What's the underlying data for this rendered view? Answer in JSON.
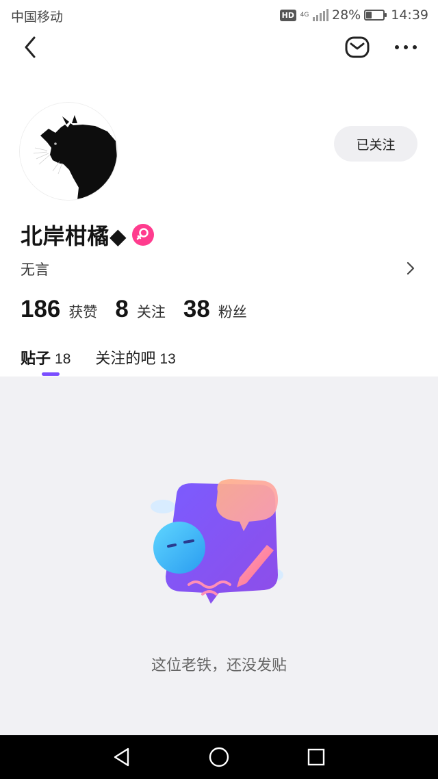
{
  "status_bar": {
    "carrier": "中国移动",
    "hd": "HD",
    "network": "4G",
    "battery_percent": "28%",
    "battery_level": 0.28,
    "time": "14:39"
  },
  "nav": {
    "back_icon": "chevron-left-icon",
    "mail_icon": "mail-icon",
    "more_icon": "more-horizontal-icon"
  },
  "profile": {
    "avatar_icon": "black-cat-avatar",
    "follow_label": "已关注",
    "username": "北岸柑橘◆",
    "gender_icon": "female-icon",
    "bio": "无言",
    "bio_arrow_icon": "chevron-right-icon"
  },
  "stats": [
    {
      "value": "186",
      "label": "获赞"
    },
    {
      "value": "8",
      "label": "关注"
    },
    {
      "value": "38",
      "label": "粉丝"
    }
  ],
  "tabs": [
    {
      "label": "贴子",
      "count": "18",
      "active": true
    },
    {
      "label": "关注的吧",
      "count": "13",
      "active": false
    }
  ],
  "empty_state": {
    "illustration_icon": "empty-posts-illustration",
    "message": "这位老铁，还没发贴"
  },
  "colors": {
    "accent": "#7a4dff",
    "female_badge": "#ff3c8e",
    "content_background": "#f1f1f4"
  }
}
